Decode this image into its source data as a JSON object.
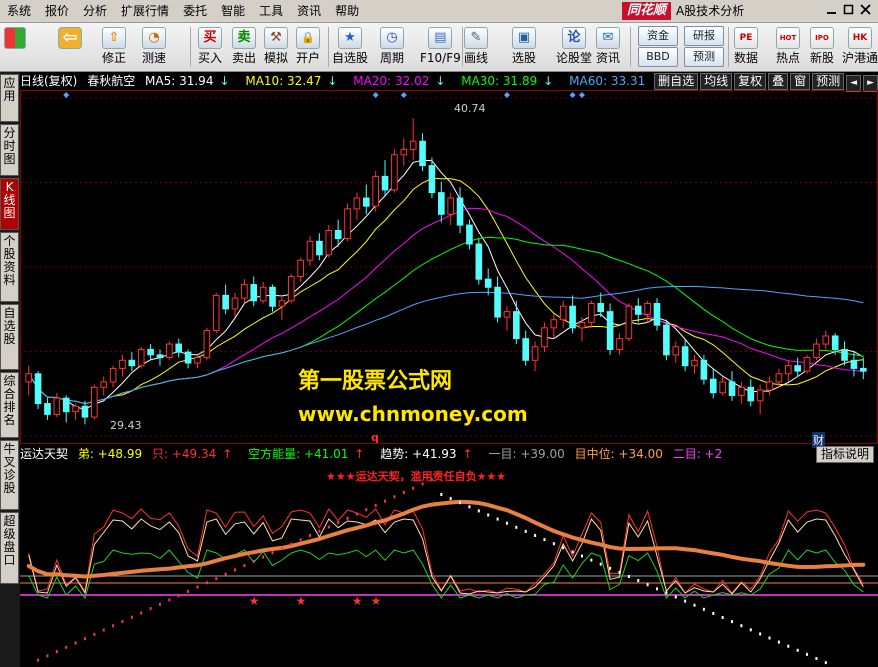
{
  "menu": [
    "系统",
    "报价",
    "分析",
    "扩展行情",
    "委托",
    "智能",
    "工具",
    "资讯",
    "帮助"
  ],
  "brand": "同花顺",
  "app_title": "A股技术分析",
  "toolbar": [
    {
      "label": "",
      "icon": "grid-icon"
    },
    {
      "label": "",
      "icon": "back-icon"
    },
    {
      "label": "修正",
      "icon": "revise-icon"
    },
    {
      "label": "测速",
      "icon": "clock-icon"
    },
    {
      "label": "买入",
      "icon": "buy-icon",
      "glyph": "买"
    },
    {
      "label": "卖出",
      "icon": "sell-icon",
      "glyph": "卖"
    },
    {
      "label": "模拟",
      "icon": "hammer-icon"
    },
    {
      "label": "开户",
      "icon": "lock-icon"
    },
    {
      "label": "自选股",
      "icon": "star-icon"
    },
    {
      "label": "周期",
      "icon": "cycle-icon"
    },
    {
      "label": "F10/F9",
      "icon": "f10-icon"
    },
    {
      "label": "画线",
      "icon": "pencil-icon"
    },
    {
      "label": "选股",
      "icon": "monitor-icon"
    },
    {
      "label": "论股堂",
      "icon": "forum-icon"
    },
    {
      "label": "资讯",
      "icon": "news-icon"
    },
    {
      "label": "资金",
      "icon": "fund-icon"
    },
    {
      "label": "BBD",
      "icon": "bbd-icon"
    },
    {
      "label": "研报",
      "icon": "report-icon"
    },
    {
      "label": "预测",
      "icon": "forecast-icon"
    },
    {
      "label": "数据",
      "icon": "pe-icon",
      "glyph": "PE"
    },
    {
      "label": "热点",
      "icon": "hot-icon",
      "glyph": "HOT"
    },
    {
      "label": "新股",
      "icon": "ipo-icon",
      "glyph": "IPO"
    },
    {
      "label": "沪港通",
      "icon": "hk-icon",
      "glyph": "HK"
    }
  ],
  "left_tabs": [
    "应用",
    "分时图",
    "K线图",
    "个股资料",
    "自选股",
    "综合排名",
    "牛叉诊股",
    "超级盘口"
  ],
  "active_tab": "K线图",
  "kline_info": {
    "period": "日线(复权)",
    "name": "春秋航空",
    "ma5": "MA5: 31.94",
    "ma10": "MA10: 32.47",
    "ma20": "MA20: 32.02",
    "ma30": "MA30: 31.89",
    "ma60": "MA60: 33.31"
  },
  "right_buttons": [
    "删自选",
    "均线",
    "复权",
    "叠",
    "窗",
    "预测"
  ],
  "high_label": "40.74",
  "low_label": "29.43",
  "q_mark": "q",
  "cai_mark": "财",
  "watermark_cn": "第一股票公式网",
  "watermark_url": "www.chnmoney.com",
  "indicator": {
    "name": "运达天契",
    "di": "弟: +48.99",
    "zhi": "只: +49.34",
    "kongfang": "空方能量: +41.01",
    "qushi": "趋势: +41.93",
    "yimu": "一目: +39.00",
    "muzhongwei": "目中位: +34.00",
    "ermu": "二目: +2",
    "title": "★★★运达天契，滥用责任自负★★★",
    "button": "指标说明"
  },
  "colors": {
    "ma5": "#ffffff",
    "ma10": "#ffff00",
    "ma20": "#ff00ff",
    "ma30": "#00ff00",
    "ma60": "#4da6ff",
    "up": "#ff3232",
    "down": "#54fcfc"
  },
  "chart_data": {
    "type": "candlestick",
    "ohlc": [
      [
        31.0,
        31.6,
        30.5,
        31.3
      ],
      [
        31.3,
        31.4,
        30.0,
        30.2
      ],
      [
        30.2,
        30.4,
        29.6,
        29.8
      ],
      [
        29.8,
        30.6,
        29.7,
        30.4
      ],
      [
        30.4,
        30.5,
        29.5,
        29.9
      ],
      [
        29.9,
        30.2,
        29.6,
        30.1
      ],
      [
        30.1,
        30.3,
        29.43,
        29.7
      ],
      [
        29.7,
        30.9,
        29.6,
        30.8
      ],
      [
        30.8,
        31.2,
        30.5,
        31.0
      ],
      [
        31.0,
        31.6,
        30.8,
        31.5
      ],
      [
        31.5,
        32.0,
        31.2,
        31.8
      ],
      [
        31.8,
        32.1,
        31.4,
        31.6
      ],
      [
        31.6,
        32.3,
        31.5,
        32.2
      ],
      [
        32.2,
        32.4,
        31.8,
        32.0
      ],
      [
        32.0,
        32.2,
        31.6,
        31.9
      ],
      [
        31.9,
        32.5,
        31.8,
        32.4
      ],
      [
        32.4,
        32.6,
        31.9,
        32.1
      ],
      [
        32.1,
        32.2,
        31.5,
        31.7
      ],
      [
        31.7,
        32.0,
        31.5,
        31.9
      ],
      [
        31.9,
        33.0,
        31.8,
        32.9
      ],
      [
        32.9,
        34.3,
        32.8,
        34.2
      ],
      [
        34.2,
        34.6,
        33.5,
        33.7
      ],
      [
        33.7,
        34.3,
        33.4,
        34.1
      ],
      [
        34.1,
        34.8,
        33.9,
        34.6
      ],
      [
        34.6,
        34.9,
        33.8,
        34.0
      ],
      [
        34.0,
        34.7,
        33.9,
        34.5
      ],
      [
        34.5,
        34.6,
        33.6,
        33.8
      ],
      [
        33.8,
        34.2,
        33.3,
        34.0
      ],
      [
        34.0,
        35.0,
        33.9,
        34.9
      ],
      [
        34.9,
        35.6,
        34.7,
        35.5
      ],
      [
        35.5,
        36.4,
        35.3,
        36.2
      ],
      [
        36.2,
        36.5,
        35.5,
        35.7
      ],
      [
        35.7,
        36.8,
        35.6,
        36.6
      ],
      [
        36.6,
        37.0,
        36.0,
        36.3
      ],
      [
        36.3,
        37.6,
        36.2,
        37.4
      ],
      [
        37.4,
        38.0,
        37.0,
        37.8
      ],
      [
        37.8,
        38.3,
        37.2,
        37.5
      ],
      [
        37.5,
        38.8,
        37.3,
        38.6
      ],
      [
        38.6,
        39.2,
        37.9,
        38.1
      ],
      [
        38.1,
        39.6,
        38.0,
        39.4
      ],
      [
        39.4,
        40.0,
        39.0,
        39.6
      ],
      [
        39.6,
        40.74,
        39.2,
        39.9
      ],
      [
        39.9,
        40.2,
        38.8,
        39.0
      ],
      [
        39.0,
        39.3,
        37.8,
        38.0
      ],
      [
        38.0,
        38.4,
        36.9,
        37.2
      ],
      [
        37.2,
        38.0,
        36.8,
        37.8
      ],
      [
        37.8,
        38.2,
        36.5,
        36.8
      ],
      [
        36.8,
        37.0,
        35.9,
        36.1
      ],
      [
        36.1,
        36.3,
        34.6,
        34.8
      ],
      [
        34.8,
        35.2,
        34.2,
        34.5
      ],
      [
        34.5,
        34.9,
        33.2,
        33.4
      ],
      [
        33.4,
        33.8,
        32.9,
        33.6
      ],
      [
        33.6,
        34.0,
        32.4,
        32.6
      ],
      [
        32.6,
        32.9,
        31.6,
        31.8
      ],
      [
        31.8,
        32.5,
        31.4,
        32.3
      ],
      [
        32.3,
        33.2,
        32.1,
        33.0
      ],
      [
        33.0,
        33.5,
        32.6,
        33.3
      ],
      [
        33.3,
        34.0,
        33.0,
        33.8
      ],
      [
        33.8,
        34.2,
        32.8,
        33.0
      ],
      [
        33.0,
        33.4,
        32.5,
        33.2
      ],
      [
        33.2,
        34.0,
        33.0,
        33.9
      ],
      [
        33.9,
        34.3,
        33.4,
        33.6
      ],
      [
        33.6,
        33.9,
        32.0,
        32.2
      ],
      [
        32.2,
        32.8,
        32.0,
        32.6
      ],
      [
        32.6,
        33.9,
        32.5,
        33.8
      ],
      [
        33.8,
        34.1,
        33.2,
        33.5
      ],
      [
        33.5,
        34.0,
        33.2,
        33.9
      ],
      [
        33.9,
        34.1,
        32.9,
        33.1
      ],
      [
        33.1,
        33.3,
        31.8,
        32.0
      ],
      [
        32.0,
        32.5,
        31.7,
        32.3
      ],
      [
        32.3,
        32.6,
        31.4,
        31.6
      ],
      [
        31.6,
        32.0,
        31.3,
        31.8
      ],
      [
        31.8,
        32.0,
        30.9,
        31.1
      ],
      [
        31.1,
        31.5,
        30.4,
        30.6
      ],
      [
        30.6,
        31.2,
        30.5,
        31.0
      ],
      [
        31.0,
        31.4,
        30.3,
        30.5
      ],
      [
        30.5,
        31.0,
        30.2,
        30.8
      ],
      [
        30.8,
        31.1,
        30.1,
        30.3
      ],
      [
        30.3,
        30.9,
        29.8,
        30.7
      ],
      [
        30.7,
        31.2,
        30.5,
        31.0
      ],
      [
        31.0,
        31.5,
        30.8,
        31.3
      ],
      [
        31.3,
        31.8,
        31.0,
        31.6
      ],
      [
        31.6,
        31.9,
        31.2,
        31.4
      ],
      [
        31.4,
        32.0,
        31.3,
        31.9
      ],
      [
        31.9,
        32.6,
        31.8,
        32.4
      ],
      [
        32.4,
        32.9,
        32.2,
        32.7
      ],
      [
        32.7,
        32.8,
        32.0,
        32.2
      ],
      [
        32.2,
        32.5,
        31.6,
        31.8
      ],
      [
        31.8,
        32.1,
        31.2,
        31.5
      ],
      [
        31.5,
        31.9,
        31.1,
        31.4
      ]
    ],
    "ylim": [
      29.0,
      41.5
    ],
    "ma_periods": [
      5,
      10,
      20,
      30,
      60
    ]
  }
}
